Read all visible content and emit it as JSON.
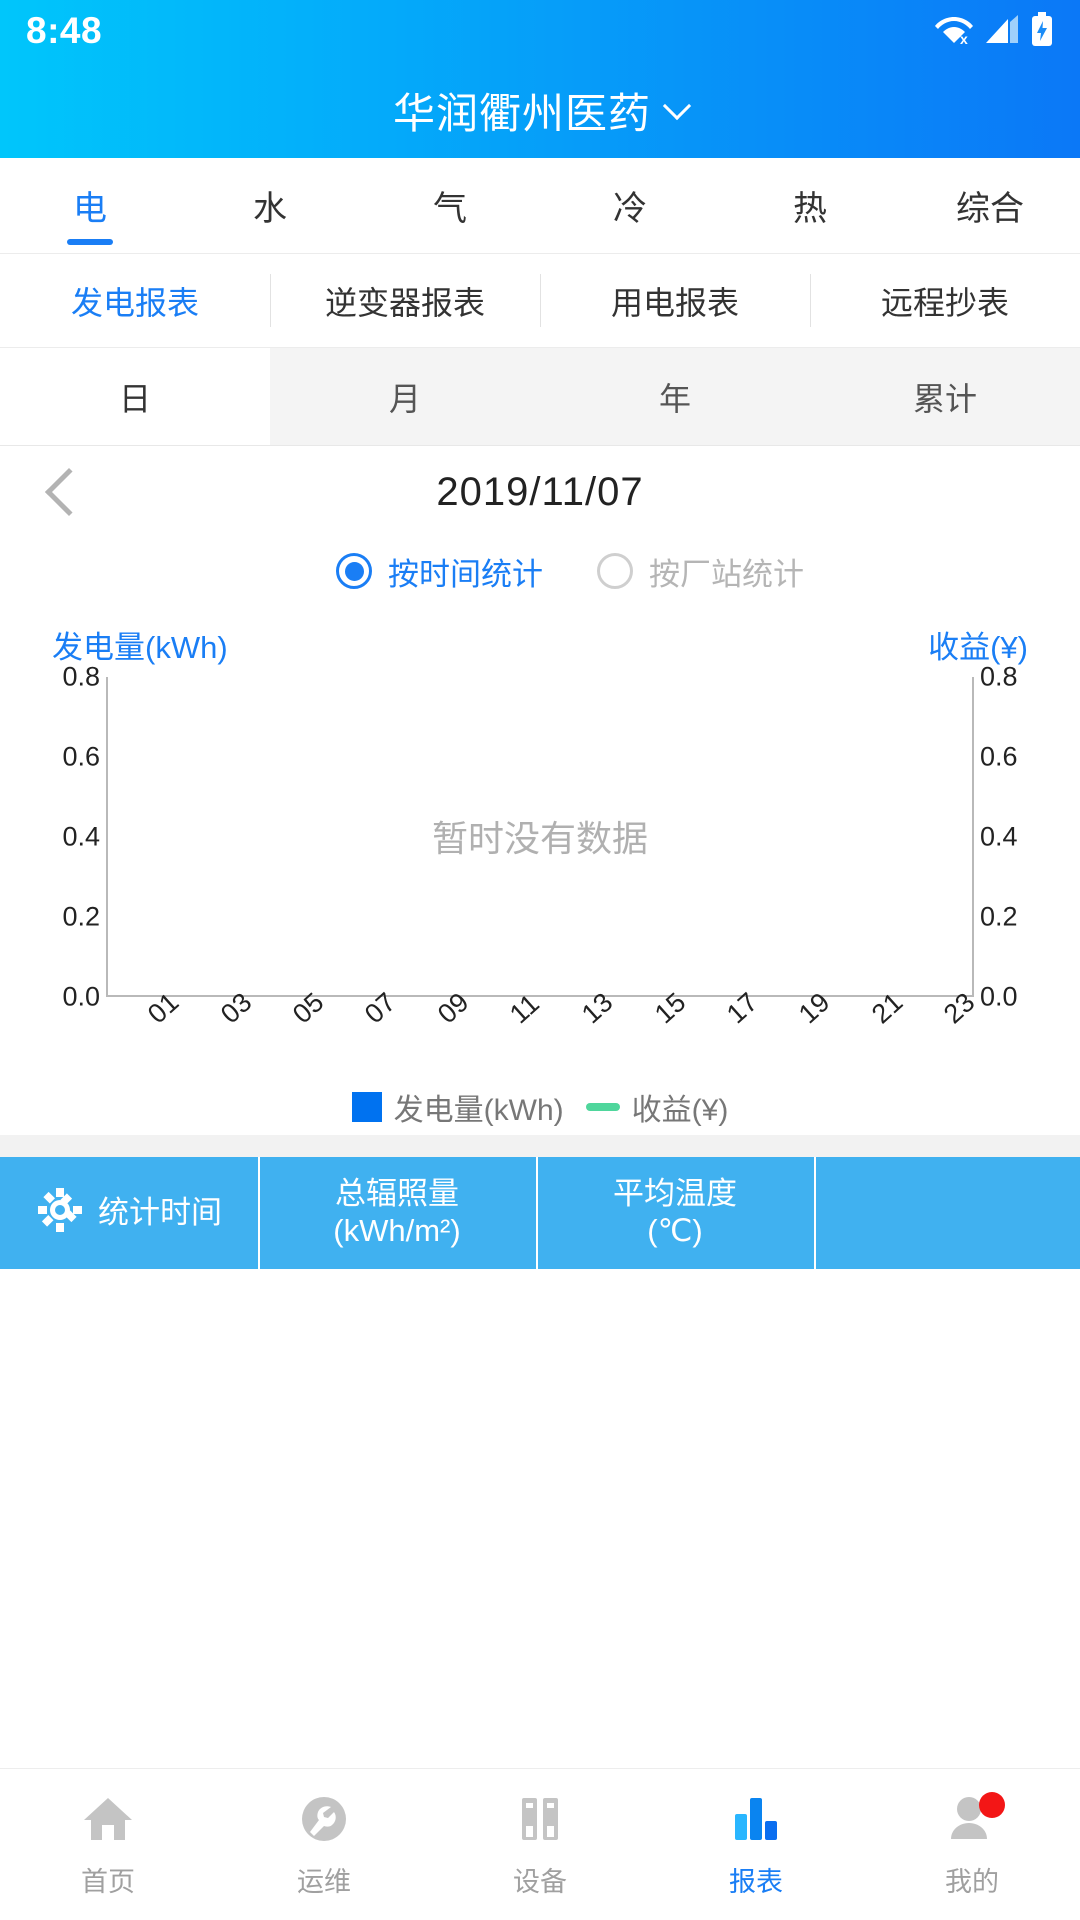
{
  "status_bar": {
    "time": "8:48",
    "icons": [
      "wifi-off-icon",
      "signal-icon",
      "battery-charging-icon"
    ]
  },
  "header": {
    "title": "华润衢州医药",
    "dropdown_icon": "chevron-down-icon",
    "gradient_start": "#00c6fb",
    "gradient_end": "#0b78f7"
  },
  "primary_tabs": {
    "active_index": 0,
    "items": [
      {
        "label": "电"
      },
      {
        "label": "水"
      },
      {
        "label": "气"
      },
      {
        "label": "冷"
      },
      {
        "label": "热"
      },
      {
        "label": "综合"
      }
    ]
  },
  "secondary_tabs": {
    "active_index": 0,
    "items": [
      {
        "label": "发电报表"
      },
      {
        "label": "逆变器报表"
      },
      {
        "label": "用电报表"
      },
      {
        "label": "远程抄表"
      }
    ]
  },
  "period_tabs": {
    "active_index": 0,
    "items": [
      {
        "label": "日"
      },
      {
        "label": "月"
      },
      {
        "label": "年"
      },
      {
        "label": "累计"
      }
    ]
  },
  "date_nav": {
    "prev_icon": "chevron-left-icon",
    "date": "2019/11/07"
  },
  "stat_mode": {
    "selected": "by-time",
    "options": [
      {
        "id": "by-time",
        "label": "按时间统计",
        "selected": true
      },
      {
        "id": "by-station",
        "label": "按厂站统计",
        "selected": false
      }
    ],
    "accent_color": "#1a7ef5"
  },
  "chart_data": {
    "type": "bar",
    "title": "",
    "empty_message": "暂时没有数据",
    "left_axis_title": "发电量(kWh)",
    "right_axis_title": "收益(¥)",
    "xlabel": "",
    "categories": [
      "01",
      "03",
      "05",
      "07",
      "09",
      "11",
      "13",
      "15",
      "17",
      "19",
      "21",
      "23"
    ],
    "y_ticks": [
      "0.0",
      "0.2",
      "0.4",
      "0.6",
      "0.8"
    ],
    "y_ticks_right": [
      "0.0",
      "0.2",
      "0.4",
      "0.6",
      "0.8"
    ],
    "ylim": [
      0,
      1.0
    ],
    "grid": false,
    "legend_position": "bottom",
    "series": [
      {
        "name": "发电量(kWh)",
        "type": "bar",
        "color": "#0072f0",
        "values": []
      },
      {
        "name": "收益(¥)",
        "type": "line",
        "color": "#4fd69c",
        "values": []
      }
    ]
  },
  "stats_strip": {
    "background": "#40b1f0",
    "cells": [
      {
        "icon": "gear-icon",
        "line1": "统计时间",
        "line2": ""
      },
      {
        "icon": "",
        "line1": "总辐照量",
        "line2": "(kWh/m²)"
      },
      {
        "icon": "",
        "line1": "平均温度",
        "line2": "(℃)"
      },
      {
        "icon": "",
        "line1": "",
        "line2": ""
      }
    ]
  },
  "bottom_nav": {
    "active_index": 3,
    "items": [
      {
        "label": "首页",
        "icon": "home-icon",
        "badge": false
      },
      {
        "label": "运维",
        "icon": "wrench-icon",
        "badge": false
      },
      {
        "label": "设备",
        "icon": "devices-icon",
        "badge": false
      },
      {
        "label": "报表",
        "icon": "bar-chart-icon",
        "badge": false
      },
      {
        "label": "我的",
        "icon": "person-icon",
        "badge": true
      }
    ]
  }
}
